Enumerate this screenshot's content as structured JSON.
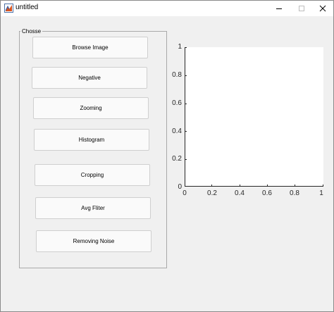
{
  "window": {
    "title": "untitled"
  },
  "panel": {
    "title": "Chosse"
  },
  "buttons": [
    {
      "label": "Browse Image"
    },
    {
      "label": "Negative"
    },
    {
      "label": "Zooming"
    },
    {
      "label": "Histogram"
    },
    {
      "label": "Cropping"
    },
    {
      "label": "Avg Fliter"
    },
    {
      "label": "Removing Noise"
    }
  ],
  "axes": {
    "y_ticks": [
      "0",
      "0.2",
      "0.4",
      "0.6",
      "0.8",
      "1"
    ],
    "x_ticks": [
      "0",
      "0.2",
      "0.4",
      "0.6",
      "0.8",
      "1"
    ]
  }
}
